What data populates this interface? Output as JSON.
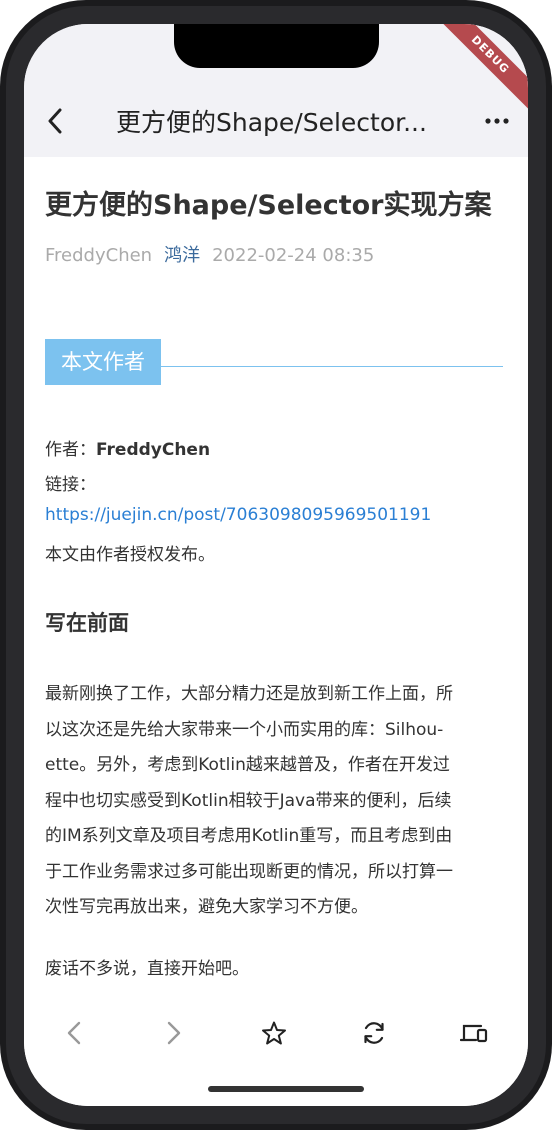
{
  "debug_banner": "DEBUG",
  "appbar": {
    "title": "更方便的Shape/Selector...",
    "back_icon": "chevron-left-icon",
    "more_icon": "more-horizontal-icon"
  },
  "article": {
    "title": "更方便的Shape/Selector实现方案",
    "author": "FreddyChen",
    "nickname": "鸿洋",
    "date": "2022-02-24 08:35",
    "section_label": "本文作者",
    "author_line_label": "作者：",
    "author_line_value": "FreddyChen",
    "link_label": "链接：",
    "link_url": "https://juejin.cn/post/7063098095969501191",
    "authorized_note": "本文由作者授权发布。",
    "heading": "写在前面",
    "paragraph_lines": [
      "最新刚换了工作，大部分精力还是放到新工作上面，所",
      "以这次还是先给大家带来一个小而实用的库：Silhou-",
      "ette。另外，考虑到Kotlin越来越普及，作者在开发过",
      "程中也切实感受到Kotlin相较于Java带来的便利，后续",
      "的IM系列文章及项目考虑用Kotlin重写，而且考虑到由",
      "于工作业务需求过多可能出现断更的情况，所以打算一",
      "次性写完再放出来，避免大家学习不方便。"
    ],
    "closing": "废话不多说，直接开始吧。"
  },
  "toolbar": {
    "items": [
      {
        "icon": "arrow-back-icon"
      },
      {
        "icon": "arrow-forward-icon"
      },
      {
        "icon": "star-icon"
      },
      {
        "icon": "refresh-icon"
      },
      {
        "icon": "devices-icon"
      }
    ]
  },
  "colors": {
    "accent": "#7cc2ef",
    "link": "#2a7fd4",
    "nickname": "#3b6a9c",
    "appbar_bg": "#f2f2f6",
    "debug": "#b54a4e"
  }
}
